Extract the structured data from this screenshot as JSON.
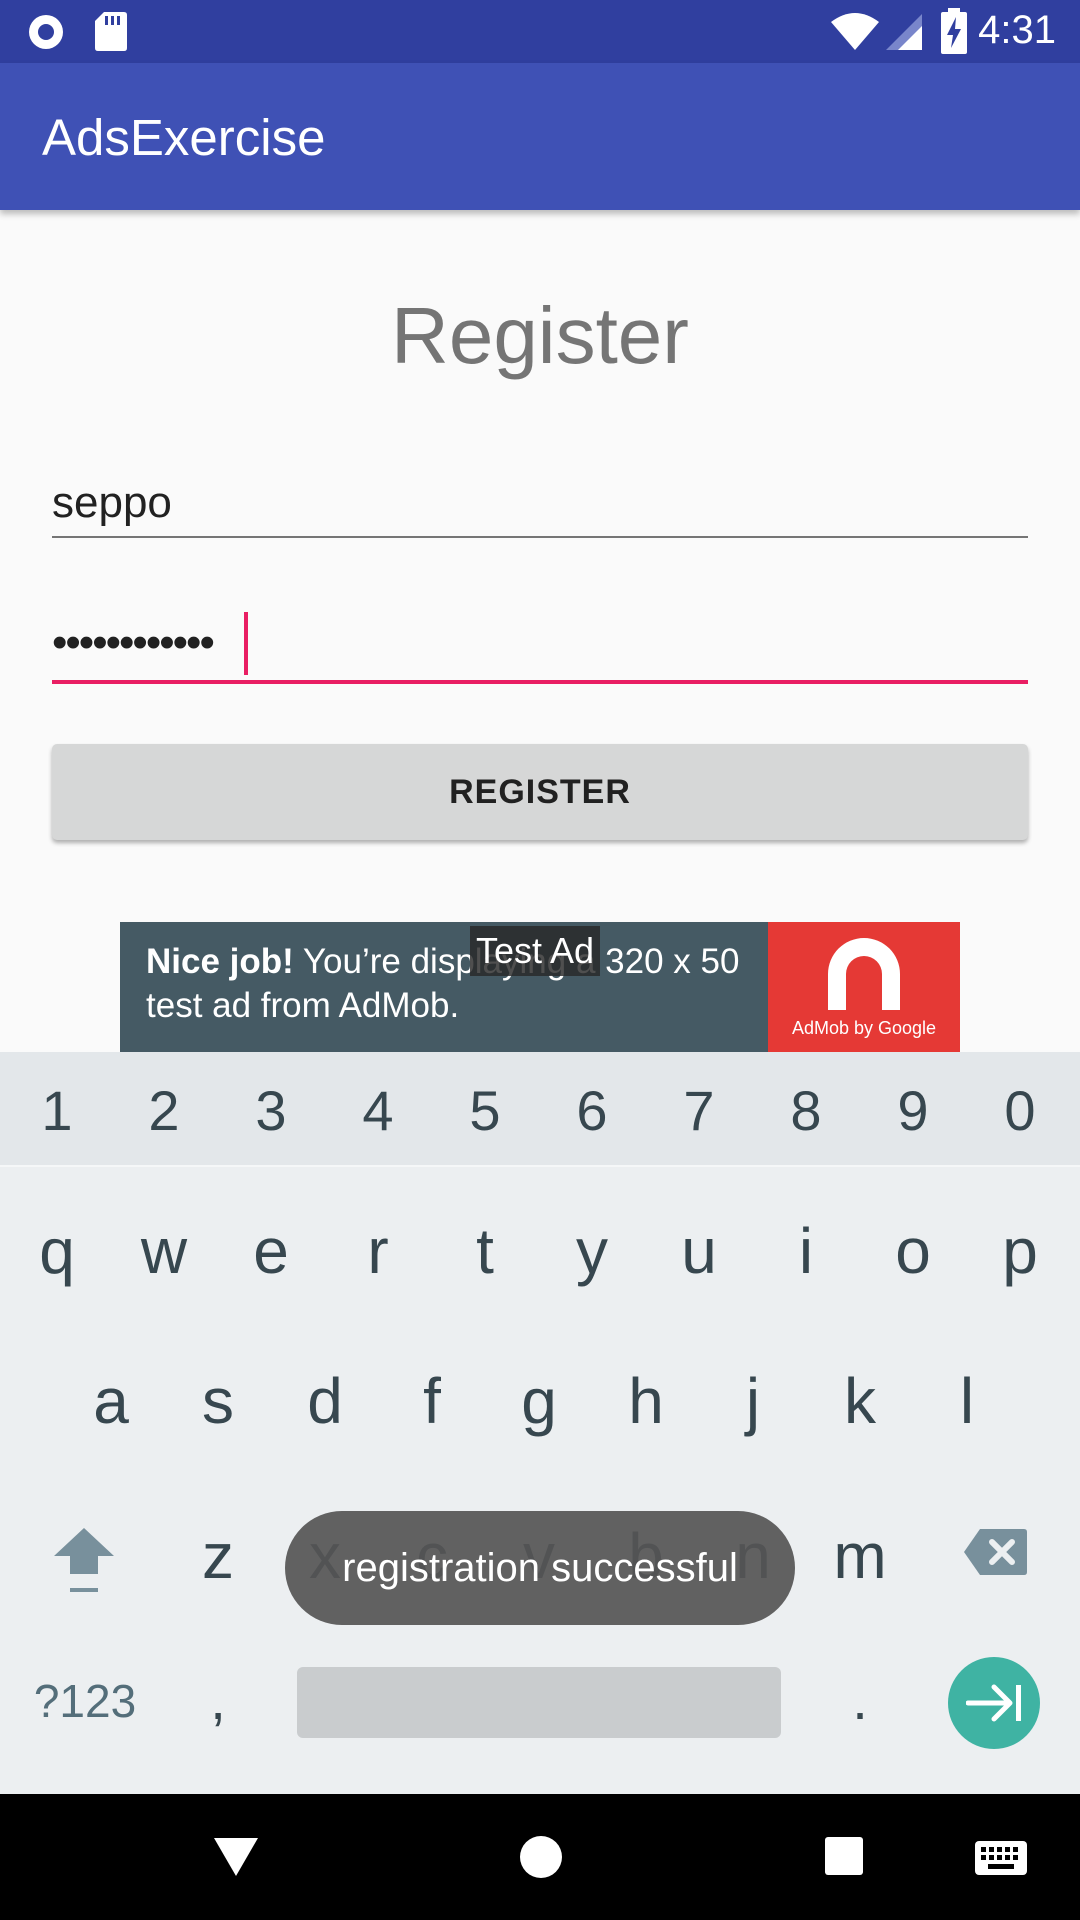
{
  "status_bar": {
    "time": "4:31",
    "icons": [
      "record-icon",
      "sd-card-icon",
      "wifi-icon",
      "signal-icon",
      "battery-charging-icon"
    ]
  },
  "app_bar": {
    "title": "AdsExercise"
  },
  "form": {
    "heading": "Register",
    "username_value": "seppo",
    "password_value": "••••••••••••",
    "register_label": "REGISTER",
    "accent_color": "#e91e63"
  },
  "ad": {
    "bold": "Nice job!",
    "text_line1": " You’re displaying a 320 x 50",
    "text_line2": "test ad from AdMob.",
    "badge": "Test Ad",
    "logo_text": "AdMob by Google"
  },
  "keyboard": {
    "numbers": [
      "1",
      "2",
      "3",
      "4",
      "5",
      "6",
      "7",
      "8",
      "9",
      "0"
    ],
    "row1": [
      "q",
      "w",
      "e",
      "r",
      "t",
      "y",
      "u",
      "i",
      "o",
      "p"
    ],
    "row2": [
      "a",
      "s",
      "d",
      "f",
      "g",
      "h",
      "j",
      "k",
      "l"
    ],
    "row3": [
      "z",
      "x",
      "c",
      "v",
      "b",
      "n",
      "m"
    ],
    "symbols_label": "?123",
    "comma": ",",
    "period": ".",
    "shift_icon": "shift-icon",
    "backspace_icon": "backspace-icon",
    "enter_icon": "next-tab-icon"
  },
  "toast": "registration successful",
  "nav_bar": {
    "icons": [
      "back-icon",
      "home-icon",
      "recents-icon",
      "keyboard-icon"
    ]
  }
}
